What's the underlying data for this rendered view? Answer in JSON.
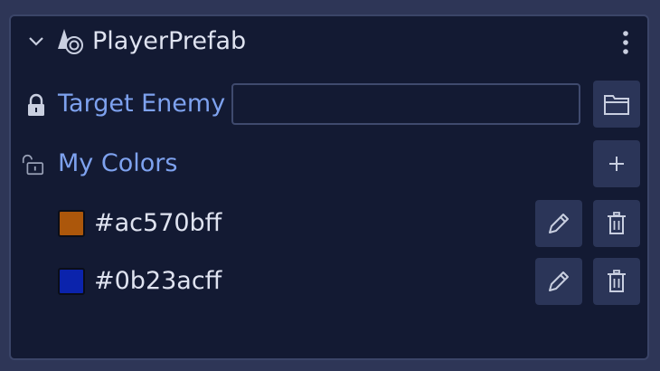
{
  "component": {
    "title": "PlayerPrefab",
    "icon": "prefab-icon"
  },
  "target_enemy": {
    "label": "Target Enemy",
    "value": "",
    "locked": true
  },
  "my_colors": {
    "label": "My Colors",
    "locked": false,
    "items": [
      {
        "hex": "#ac570bff",
        "color": "#ac570b"
      },
      {
        "hex": "#0b23acff",
        "color": "#0b23ac"
      }
    ]
  },
  "colors": {
    "panel_bg": "#131a33",
    "accent_label": "#7ea2ef",
    "button_bg": "#2b3558"
  }
}
